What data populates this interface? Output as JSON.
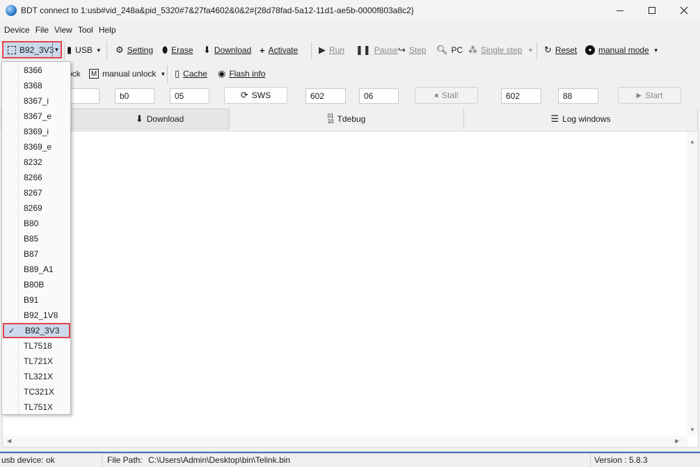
{
  "window": {
    "title": "BDT connect to 1:usb#vid_248a&pid_5320#7&27fa4602&0&2#{28d78fad-5a12-11d1-ae5b-0000f803a8c2}"
  },
  "menu": [
    "Device",
    "File",
    "View",
    "Tool",
    "Help"
  ],
  "toolbar1": {
    "chip": "B92_3V3",
    "usb": "USB",
    "setting": "Setting",
    "erase": "Erase",
    "download": "Download",
    "activate": "Activate",
    "run": "Run",
    "pause": "Pause",
    "step": "Step",
    "pc": "PC",
    "single_step": "Single step",
    "reset": "Reset",
    "manual_mode": "manual mode"
  },
  "toolbar2": {
    "unlock_partial": "ock",
    "manual_unlock": "manual unlock",
    "cache": "Cache",
    "flash_info": "Flash info"
  },
  "fields": {
    "f1": "b0",
    "f2": "05",
    "sws": "SWS",
    "f3": "602",
    "f4": "06",
    "stall": "Stall",
    "f5": "602",
    "f6": "88",
    "start": "Start"
  },
  "tabs": {
    "download": "Download",
    "tdebug": "Tdebug",
    "log": "Log windows"
  },
  "dropdown": {
    "items": [
      "8366",
      "8368",
      "8367_i",
      "8367_e",
      "8369_i",
      "8369_e",
      "8232",
      "8266",
      "8267",
      "8269",
      "B80",
      "B85",
      "B87",
      "B89_A1",
      "B80B",
      "B91",
      "B92_1V8",
      "B92_3V3",
      "TL7518",
      "TL721X",
      "TL321X",
      "TC321X",
      "TL751X"
    ],
    "selected": "B92_3V3"
  },
  "status": {
    "device": "usb device: ok",
    "file_path_label": "File Path:",
    "file_path": "C:\\Users\\Admin\\Desktop\\bin\\Telink.bin",
    "version": "Version : 5.8.3"
  },
  "colors": {
    "highlight_border": "#e0434a",
    "selected_bg": "#ccd9ec",
    "status_accent": "#3a72b8"
  }
}
